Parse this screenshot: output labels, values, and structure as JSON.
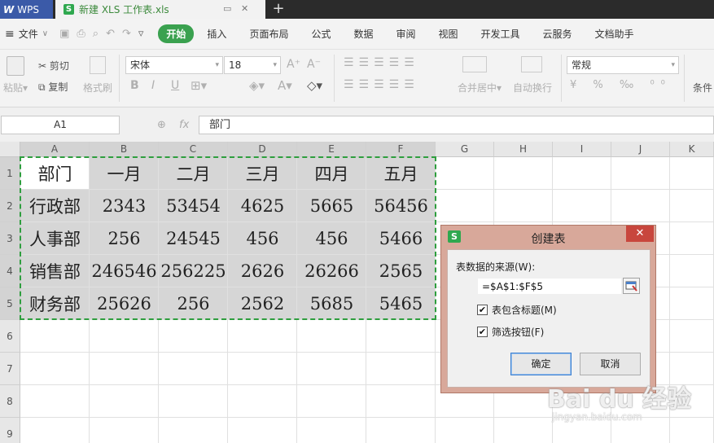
{
  "titlebar": {
    "app_label": "WPS",
    "doc_tab": "新建 XLS 工作表.xls",
    "doc_icon": "S",
    "new_tab": "+"
  },
  "menu": {
    "file": "文件",
    "items": [
      "开始",
      "插入",
      "页面布局",
      "公式",
      "数据",
      "审阅",
      "视图",
      "开发工具",
      "云服务",
      "文档助手"
    ],
    "active_index": 0
  },
  "ribbon": {
    "paste": "粘贴",
    "cut": "剪切",
    "copy": "复制",
    "format_painter": "格式刷",
    "font_name": "宋体",
    "font_size": "18",
    "merge_center": "合并居中",
    "wrap_text": "自动换行",
    "number_format": "常规",
    "conditional": "条件"
  },
  "formula_bar": {
    "name_box": "A1",
    "fx": "fx",
    "content": "部门"
  },
  "columns": [
    "A",
    "B",
    "C",
    "D",
    "E",
    "F",
    "G",
    "H",
    "I",
    "J",
    "K"
  ],
  "rows": [
    "1",
    "2",
    "3",
    "4",
    "5",
    "6",
    "7",
    "8",
    "9"
  ],
  "table": [
    [
      "部门",
      "一月",
      "二月",
      "三月",
      "四月",
      "五月"
    ],
    [
      "行政部",
      "2343",
      "53454",
      "4625",
      "5665",
      "56456"
    ],
    [
      "人事部",
      "256",
      "24545",
      "456",
      "456",
      "5466"
    ],
    [
      "销售部",
      "246546",
      "256225",
      "2626",
      "26266",
      "2565"
    ],
    [
      "财务部",
      "25626",
      "256",
      "2562",
      "5685",
      "5465"
    ]
  ],
  "dialog": {
    "icon": "S",
    "title": "创建表",
    "close": "✕",
    "source_label": "表数据的来源(W):",
    "source_value": "=$A$1:$F$5",
    "has_header_label": "表包含标题(M)",
    "has_header_checked": true,
    "filter_label": "筛选按钮(F)",
    "filter_checked": true,
    "ok": "确定",
    "cancel": "取消"
  },
  "watermark": {
    "text": "Bai du 经验",
    "url": "jingyan.baidu.com"
  },
  "colors": {
    "accent_green": "#3aa14f",
    "selection_border": "#2e9e3e",
    "dialog_frame": "#d8a89a",
    "close_red": "#c8463d"
  }
}
